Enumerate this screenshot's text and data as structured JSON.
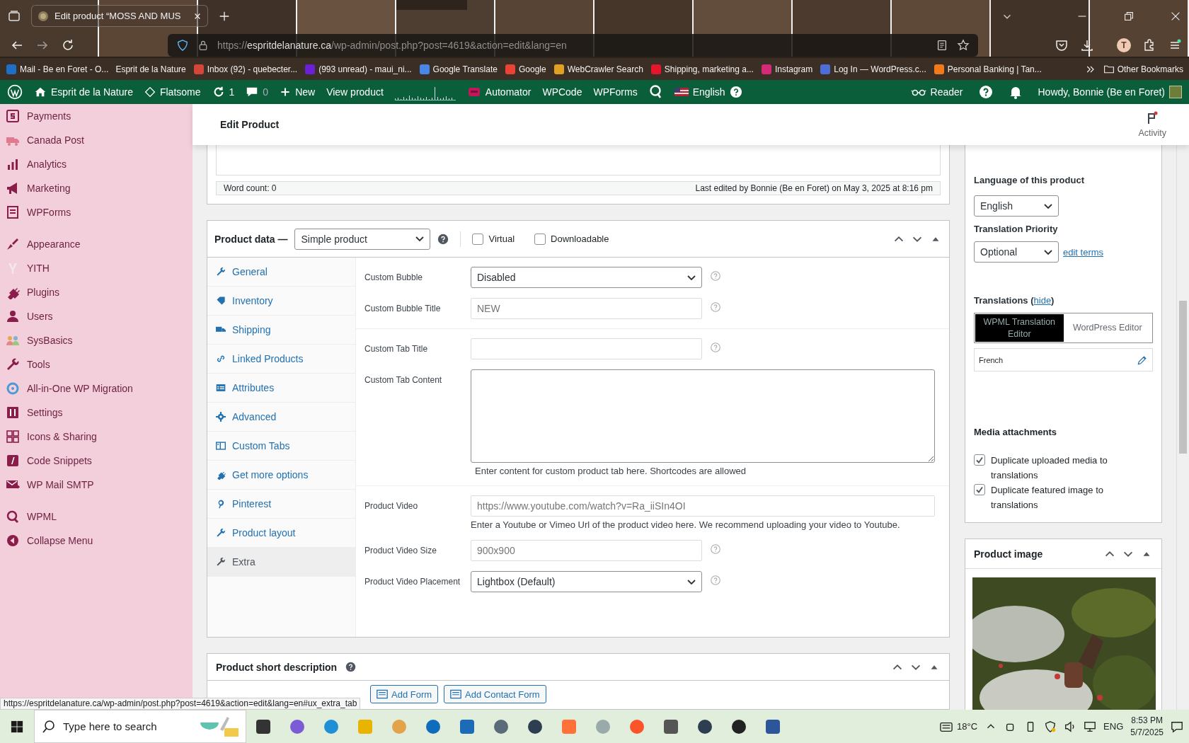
{
  "browser": {
    "tab_title": "Edit product “MOSS AND MUS",
    "url": {
      "scheme": "https://",
      "domain": "espritdelanature.ca",
      "path": "/wp-admin/post.php?post=4619&action=edit&lang=en"
    },
    "profile_initial": "T",
    "bookmarks": [
      "Mail - Be en Foret - O...",
      "Esprit de la Nature",
      "Inbox (92) - quebecter...",
      "(993 unread) - maui_ni...",
      "Google Translate",
      "Google",
      "WebCrawler Search",
      "Shipping, marketing a...",
      "Instagram",
      "Log In — WordPress.c...",
      "Personal Banking | Tan..."
    ],
    "other_bookmarks": "Other Bookmarks"
  },
  "admin_bar": {
    "left": [
      {
        "kind": "site",
        "label": "Esprit de la Nature"
      },
      {
        "kind": "theme",
        "label": "Flatsome"
      },
      {
        "kind": "updates",
        "label": "1"
      },
      {
        "kind": "comments",
        "label": "0"
      },
      {
        "kind": "new",
        "label": "New"
      },
      {
        "kind": "link",
        "label": "View product"
      },
      {
        "kind": "stats"
      },
      {
        "kind": "automator",
        "label": "Automator"
      },
      {
        "kind": "link",
        "label": "WPCode"
      },
      {
        "kind": "link",
        "label": "WPForms"
      },
      {
        "kind": "wpml"
      },
      {
        "kind": "language",
        "label": "English"
      }
    ],
    "right": [
      {
        "kind": "reader",
        "label": "Reader"
      },
      {
        "kind": "help"
      },
      {
        "kind": "notifications"
      },
      {
        "kind": "account",
        "label": "Howdy, Bonnie (Be en Foret)"
      }
    ]
  },
  "sidebar": {
    "groups": [
      [
        "Payments",
        "Canada Post",
        "Analytics",
        "Marketing",
        "WPForms"
      ],
      [
        "Appearance",
        "YITH",
        "Plugins",
        "Users",
        "SysBasics",
        "Tools",
        "All-in-One WP Migration",
        "Settings",
        "Icons & Sharing",
        "Code Snippets",
        "WP Mail SMTP"
      ],
      [
        "WPML",
        "Collapse Menu"
      ]
    ]
  },
  "page_header": {
    "title": "Edit Product",
    "activity": "Activity"
  },
  "editor": {
    "word_count": "Word count: 0",
    "last_edited": "Last edited by Bonnie (Be en Foret) on May 3, 2025 at 8:16 pm"
  },
  "product_data": {
    "label": "Product data —",
    "type": "Simple product",
    "options": [
      {
        "label": "Virtual",
        "checked": false
      },
      {
        "label": "Downloadable",
        "checked": false
      }
    ],
    "tabs": [
      {
        "label": "General",
        "selected": false
      },
      {
        "label": "Inventory",
        "selected": false
      },
      {
        "label": "Shipping",
        "selected": false
      },
      {
        "label": "Linked Products",
        "selected": false
      },
      {
        "label": "Attributes",
        "selected": false
      },
      {
        "label": "Advanced",
        "selected": false
      },
      {
        "label": "Custom Tabs",
        "selected": false
      },
      {
        "label": "Get more options",
        "selected": false
      },
      {
        "label": "Pinterest",
        "selected": false
      },
      {
        "label": "Product layout",
        "selected": false
      },
      {
        "label": "Extra",
        "selected": true
      }
    ],
    "groups": [
      [
        {
          "kind": "select",
          "label": "Custom Bubble",
          "value": "Disabled",
          "help": true
        },
        {
          "kind": "text",
          "label": "Custom Bubble Title",
          "placeholder": "NEW",
          "help": true
        }
      ],
      [
        {
          "kind": "text",
          "label": "Custom Tab Title",
          "help": true
        },
        {
          "kind": "textarea",
          "label": "Custom Tab Content",
          "help": false,
          "description": "Enter content for custom product tab here. Shortcodes are allowed"
        }
      ],
      [
        {
          "kind": "url",
          "label": "Product Video",
          "placeholder": "https://www.youtube.com/watch?v=Ra_iiSIn4OI",
          "help": false,
          "description": "Enter a Youtube or Vimeo Url of the product video here. We recommend uploading your video to Youtube."
        },
        {
          "kind": "text",
          "label": "Product Video Size",
          "placeholder": "900x900",
          "help": true
        },
        {
          "kind": "select",
          "label": "Product Video Placement",
          "value": "Lightbox (Default)",
          "help": true
        }
      ]
    ]
  },
  "short_description": {
    "title": "Product short description",
    "buttons": [
      "Add Form",
      "Add Contact Form"
    ]
  },
  "language_box": {
    "language_label": "Language of this product",
    "language": "English",
    "priority_label": "Translation Priority",
    "priority": "Optional",
    "edit_terms": "edit terms",
    "translations": {
      "label": "Translations",
      "open": "(",
      "link": "hide",
      "close": ")"
    },
    "editors": [
      {
        "label": "WPML Translation Editor",
        "selected": true
      },
      {
        "label": "WordPress Editor",
        "selected": false
      }
    ],
    "languages": [
      {
        "label": "French"
      }
    ],
    "media_title": "Media attachments",
    "media_options": [
      {
        "label": "Duplicate uploaded media to translations",
        "checked": true
      },
      {
        "label": "Duplicate featured image to translations",
        "checked": true
      }
    ]
  },
  "product_image": {
    "title": "Product image"
  },
  "status_url": "https://espritdelanature.ca/wp-admin/post.php?post=4619&action=edit&lang=en#ux_extra_tab",
  "taskbar": {
    "search_placeholder": "Type here to search",
    "temperature": "18°C",
    "input_language": "ENG",
    "time": "8:53 PM",
    "date": "5/7/2025"
  }
}
